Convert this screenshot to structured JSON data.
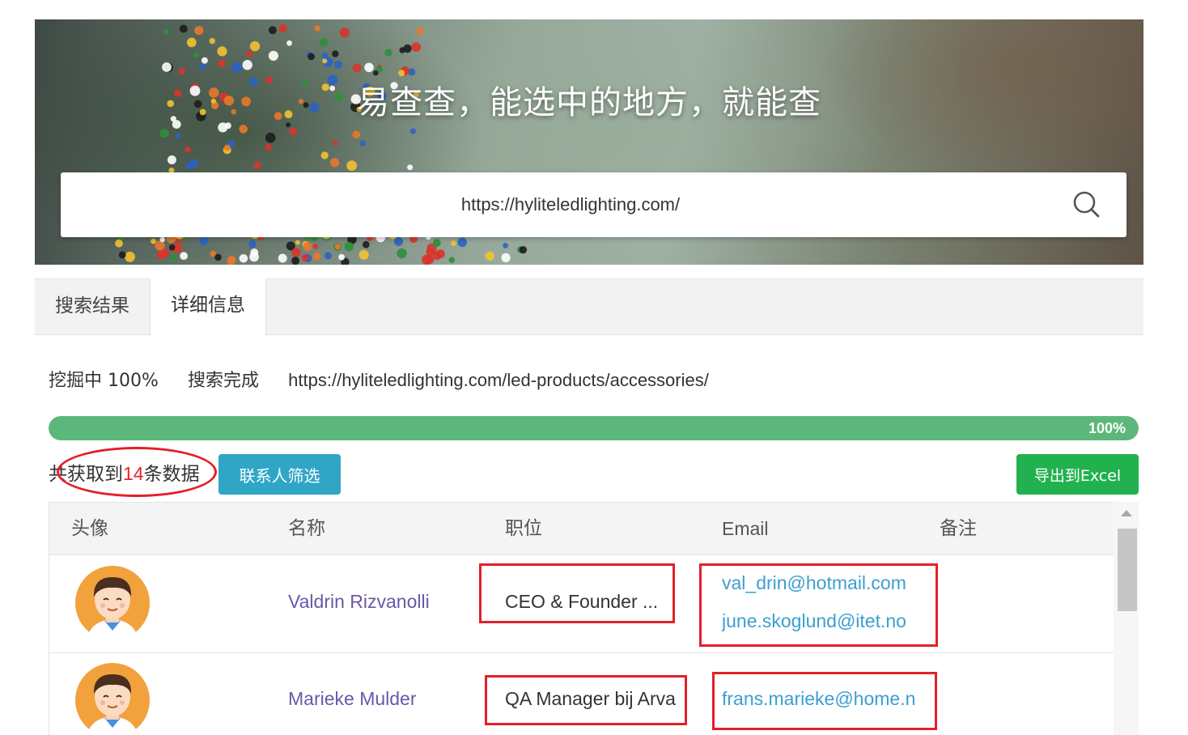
{
  "hero": {
    "title": "易查查，能选中的地方，就能查"
  },
  "search": {
    "value": "https://hyliteledlighting.com/"
  },
  "tabs": [
    {
      "label": "搜索结果",
      "active": false
    },
    {
      "label": "详细信息",
      "active": true
    }
  ],
  "status": {
    "progress_text": "挖掘中 100%",
    "state_text": "搜索完成",
    "url": "https://hyliteledlighting.com/led-products/accessories/"
  },
  "progress": {
    "value": 1.0,
    "label": "100%",
    "color": "#5cb77a"
  },
  "summary": {
    "prefix": "共获取到",
    "count": "14",
    "suffix": "条数据",
    "count_color": "#e8232f"
  },
  "buttons": {
    "filter_label": "联系人筛选",
    "export_label": "导出到Excel",
    "filter_color": "#2fa6c6",
    "export_color": "#21b24f"
  },
  "table": {
    "headers": [
      "头像",
      "名称",
      "职位",
      "Email",
      "备注"
    ],
    "rows": [
      {
        "name": "Valdrin Rizvanolli",
        "title": "CEO & Founder ...",
        "emails": [
          "val_drin@hotmail.com",
          "june.skoglund@itet.no"
        ],
        "note": ""
      },
      {
        "name": "Marieke Mulder",
        "title": "QA Manager bij Arva",
        "emails": [
          "frans.marieke@home.n"
        ],
        "note": ""
      }
    ]
  },
  "colors": {
    "name_link": "#6b57a8",
    "email_link": "#3b9fd1",
    "annotation_red": "#e3202a"
  },
  "icons": {
    "search": "search-icon",
    "avatar": "avatar-icon",
    "scroll_up": "scroll-up-arrow-icon"
  }
}
